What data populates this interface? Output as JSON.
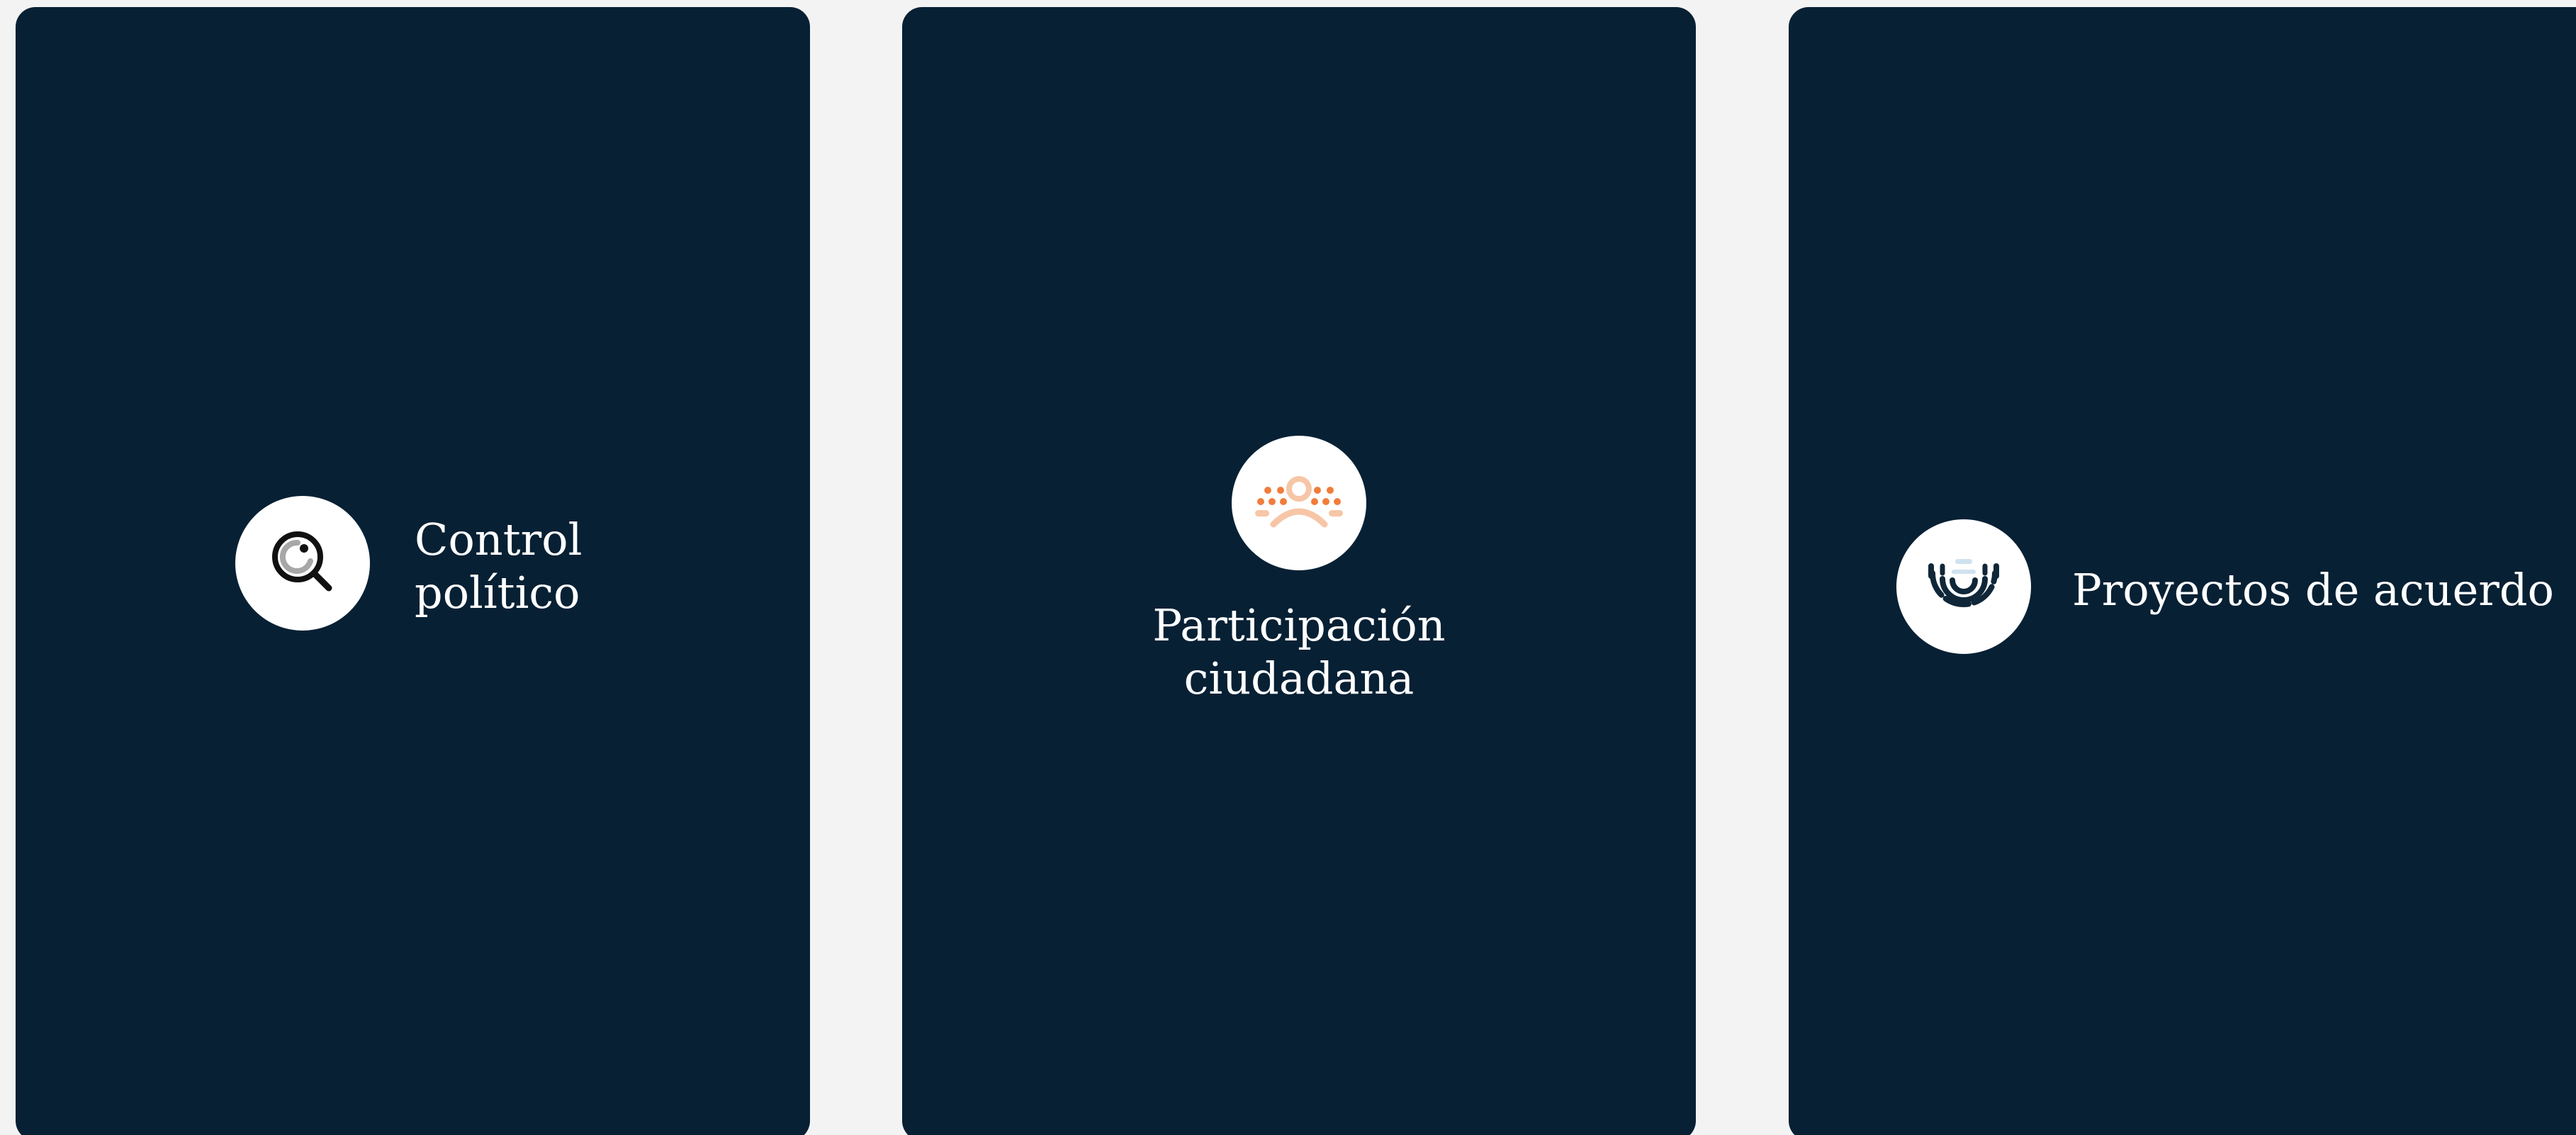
{
  "cards": [
    {
      "title_lines": [
        "Control",
        "político"
      ],
      "icon": "magnifier-icon",
      "icon_colors": {
        "glass": "#111111",
        "inner": "#a7a7a7"
      }
    },
    {
      "title_lines": [
        "Participación",
        "ciudadana"
      ],
      "icon": "citizens-icon",
      "icon_colors": {
        "dots": "#f07d3c",
        "person": "#f6c6a6"
      }
    },
    {
      "title_lines": [
        "Proyectos de acuerdo"
      ],
      "icon": "assembly-icon",
      "icon_colors": {
        "arcs": "#0f2738",
        "top": "#cfe2ef"
      }
    }
  ],
  "colors": {
    "page_background": "#f3f3f3",
    "card_background": "#072034",
    "badge_background": "#ffffff",
    "text": "#ffffff"
  }
}
